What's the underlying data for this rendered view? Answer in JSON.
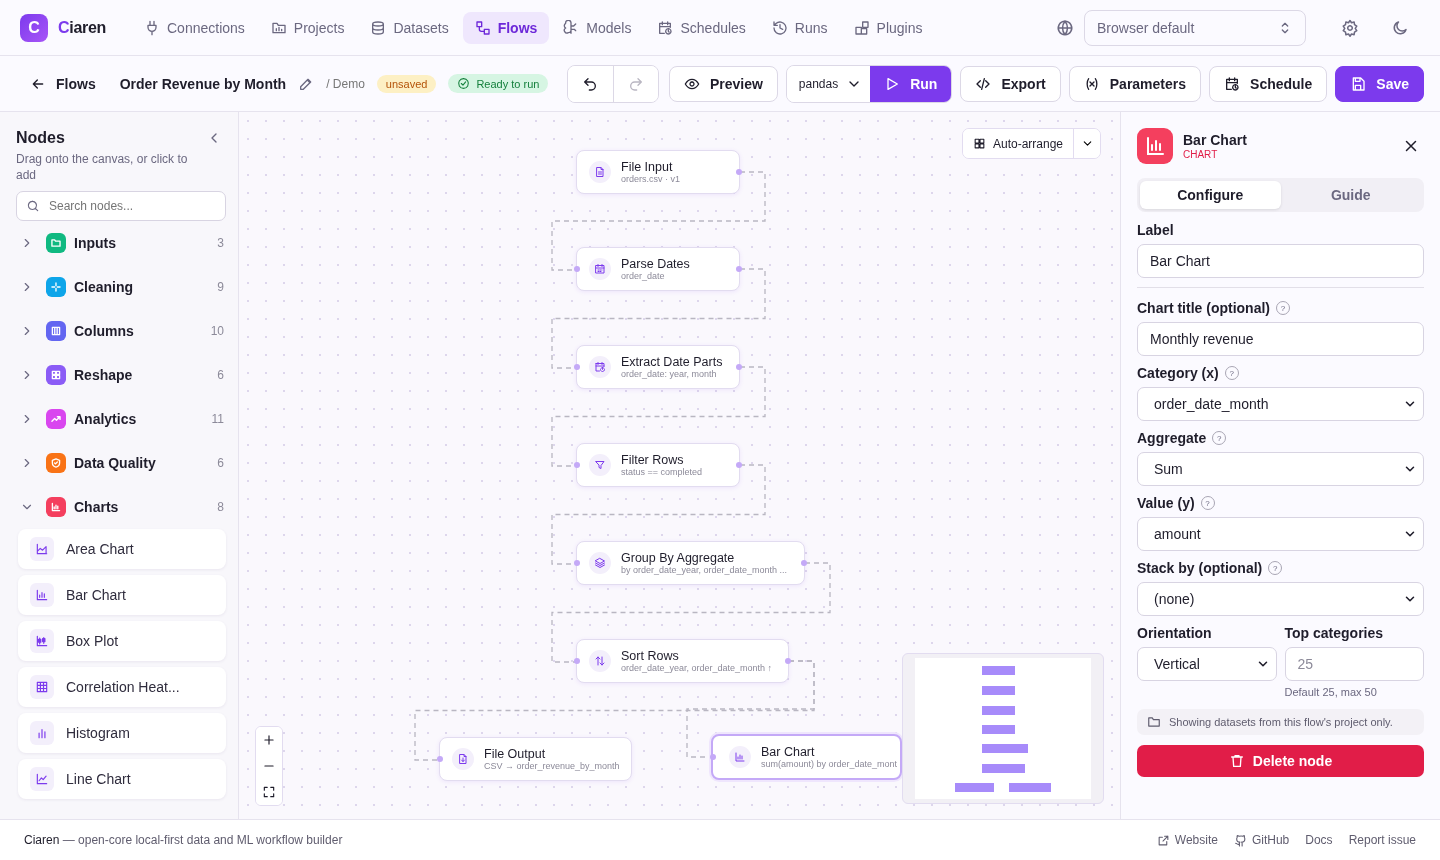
{
  "app": {
    "logo_letter": "C",
    "name": "Ciaren"
  },
  "nav": [
    {
      "label": "Connections",
      "selected": false
    },
    {
      "label": "Projects",
      "selected": false
    },
    {
      "label": "Datasets",
      "selected": false
    },
    {
      "label": "Flows",
      "selected": true
    },
    {
      "label": "Models",
      "selected": false
    },
    {
      "label": "Schedules",
      "selected": false
    },
    {
      "label": "Runs",
      "selected": false
    },
    {
      "label": "Plugins",
      "selected": false
    }
  ],
  "language_select": {
    "value": "Browser default"
  },
  "toolbar": {
    "back": "Flows",
    "title": "Order Revenue by Month",
    "project": "/ Demo",
    "unsaved_badge": "unsaved",
    "status_badge": "Ready to run",
    "undo_disabled": false,
    "redo_disabled": true,
    "preview": "Preview",
    "engine": "pandas",
    "run": "Run",
    "export": "Export",
    "parameters": "Parameters",
    "schedule": "Schedule",
    "save": "Save"
  },
  "sidebar": {
    "title": "Nodes",
    "subtitle": "Drag onto the canvas, or click to add",
    "search": {
      "placeholder": "Search nodes..."
    },
    "categories": [
      {
        "name": "Inputs",
        "count": "3",
        "color": "#10b981",
        "expanded": false
      },
      {
        "name": "Cleaning",
        "count": "9",
        "color": "#0ea5e9",
        "expanded": false
      },
      {
        "name": "Columns",
        "count": "10",
        "color": "#6366f1",
        "expanded": false
      },
      {
        "name": "Reshape",
        "count": "6",
        "color": "#8b5cf6",
        "expanded": false
      },
      {
        "name": "Analytics",
        "count": "11",
        "color": "#d946ef",
        "expanded": false
      },
      {
        "name": "Data Quality",
        "count": "6",
        "color": "#f97316",
        "expanded": false
      },
      {
        "name": "Charts",
        "count": "8",
        "color": "#f43f5e",
        "expanded": true,
        "children": [
          {
            "name": "Area Chart"
          },
          {
            "name": "Bar Chart"
          },
          {
            "name": "Box Plot"
          },
          {
            "name": "Correlation Heat..."
          },
          {
            "name": "Histogram"
          },
          {
            "name": "Line Chart"
          }
        ]
      }
    ]
  },
  "canvas": {
    "auto_arrange": "Auto-arrange",
    "nodes": [
      {
        "title": "File Input",
        "subtitle": "orders.csv · v1",
        "selected": false
      },
      {
        "title": "Parse Dates",
        "subtitle": "order_date",
        "selected": false
      },
      {
        "title": "Extract Date Parts",
        "subtitle": "order_date: year, month",
        "selected": false
      },
      {
        "title": "Filter Rows",
        "subtitle": "status == completed",
        "selected": false
      },
      {
        "title": "Group By Aggregate",
        "subtitle": "by order_date_year, order_date_month ...",
        "selected": false
      },
      {
        "title": "Sort Rows",
        "subtitle": "order_date_year, order_date_month ↑",
        "selected": false
      },
      {
        "title": "File Output",
        "subtitle": "CSV → order_revenue_by_month",
        "selected": false
      },
      {
        "title": "Bar Chart",
        "subtitle": "sum(amount) by order_date_mont",
        "selected": true
      }
    ]
  },
  "inspector": {
    "title": "Bar Chart",
    "category": "CHART",
    "tabs": [
      {
        "label": "Configure",
        "selected": true
      },
      {
        "label": "Guide",
        "selected": false
      }
    ],
    "fields": [
      {
        "kind": "input",
        "label": "Label",
        "value": "Bar Chart"
      },
      {
        "kind": "input",
        "label": "Chart title (optional)",
        "help": "?",
        "value": "Monthly revenue"
      },
      {
        "kind": "select",
        "label": "Category (x)",
        "help": "?",
        "value": "order_date_month"
      },
      {
        "kind": "select",
        "label": "Aggregate",
        "help": "?",
        "value": "Sum"
      },
      {
        "kind": "select",
        "label": "Value (y)",
        "help": "?",
        "value": "amount"
      },
      {
        "kind": "select",
        "label": "Stack by (optional)",
        "help": "?",
        "value": "(none)"
      }
    ],
    "pair": [
      {
        "kind": "select",
        "label": "Orientation",
        "value": "Vertical"
      },
      {
        "kind": "input",
        "label": "Top categories",
        "placeholder": "25",
        "hint": "Default 25, max 50"
      }
    ],
    "note": "Showing datasets from this flow's project only.",
    "delete": "Delete node"
  },
  "footer": {
    "brand": "Ciaren",
    "tagline": " — open-core local-first data and ML workflow builder",
    "links": [
      "Website",
      "GitHub",
      "Docs",
      "Report issue"
    ]
  }
}
